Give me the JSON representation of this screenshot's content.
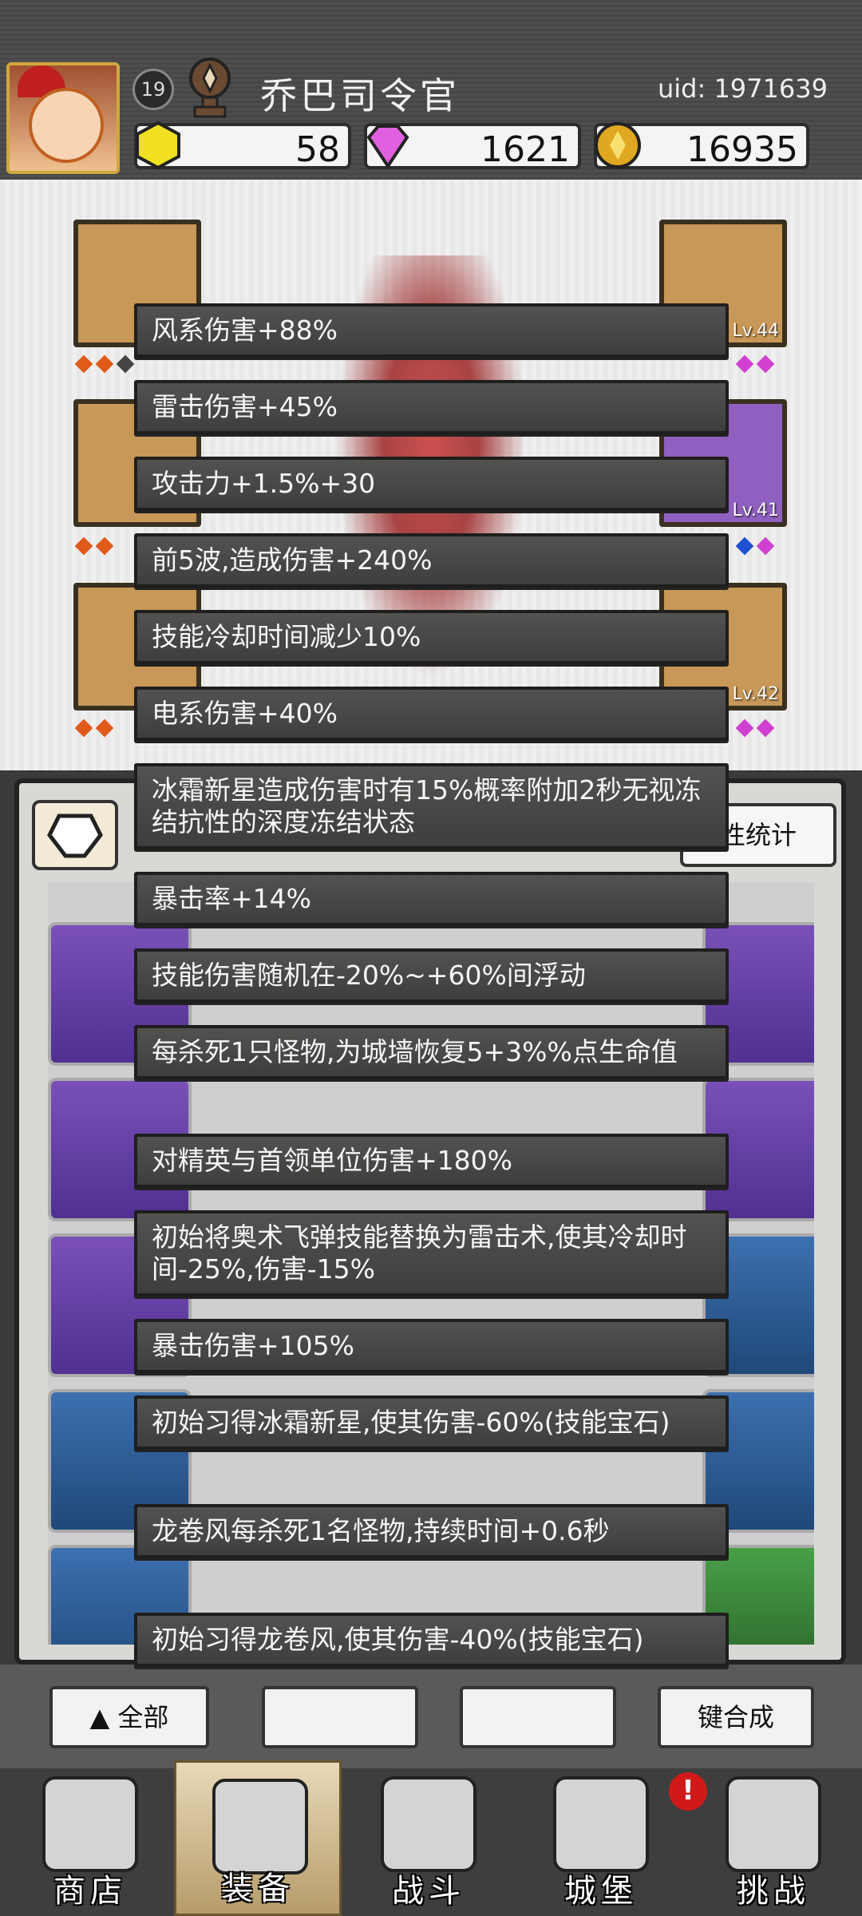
{
  "header": {
    "level": "19",
    "player_name": "乔巴司令官",
    "uid": "uid: 1971639",
    "resources": [
      {
        "icon": "yellow-gem-icon",
        "value": "58"
      },
      {
        "icon": "pink-diamond-icon",
        "value": "1621"
      },
      {
        "icon": "gold-coin-icon",
        "value": "16935"
      }
    ]
  },
  "equipment": {
    "slots_right": [
      {
        "level": "Lv.44"
      },
      {
        "level": "Lv.41"
      },
      {
        "level": "Lv.42"
      }
    ]
  },
  "inventory": {
    "stats_button": "性统计"
  },
  "tooltip_lines": [
    "风系伤害+88%",
    "雷击伤害+45%",
    "攻击力+1.5%+30",
    "前5波,造成伤害+240%",
    "技能冷却时间减少10%",
    "电系伤害+40%",
    "冰霜新星造成伤害时有15%概率附加2秒无视冻结抗性的深度冻结状态",
    "暴击率+14%",
    "技能伤害随机在-20%~+60%间浮动",
    "每杀死1只怪物,为城墙恢复5+3%%点生命值",
    "对精英与首领单位伤害+180%",
    "初始将奥术飞弹技能替换为雷击术,使其冷却时间-25%,伤害-15%",
    "暴击伤害+105%",
    "初始习得冰霜新星,使其伤害-60%(技能宝石)",
    "龙卷风每杀死1名怪物,持续时间+0.6秒",
    "初始习得龙卷风,使其伤害-40%(技能宝石)"
  ],
  "bottom_buttons": {
    "all": "全部",
    "merge": "键合成"
  },
  "nav": [
    {
      "label": "商店",
      "icon": "shop-icon"
    },
    {
      "label": "装备",
      "icon": "backpack-icon"
    },
    {
      "label": "战斗",
      "icon": "crossed-swords-icon"
    },
    {
      "label": "城堡",
      "icon": "castle-icon"
    },
    {
      "label": "挑战",
      "icon": "shield-icon"
    }
  ],
  "notification_badge": "!"
}
